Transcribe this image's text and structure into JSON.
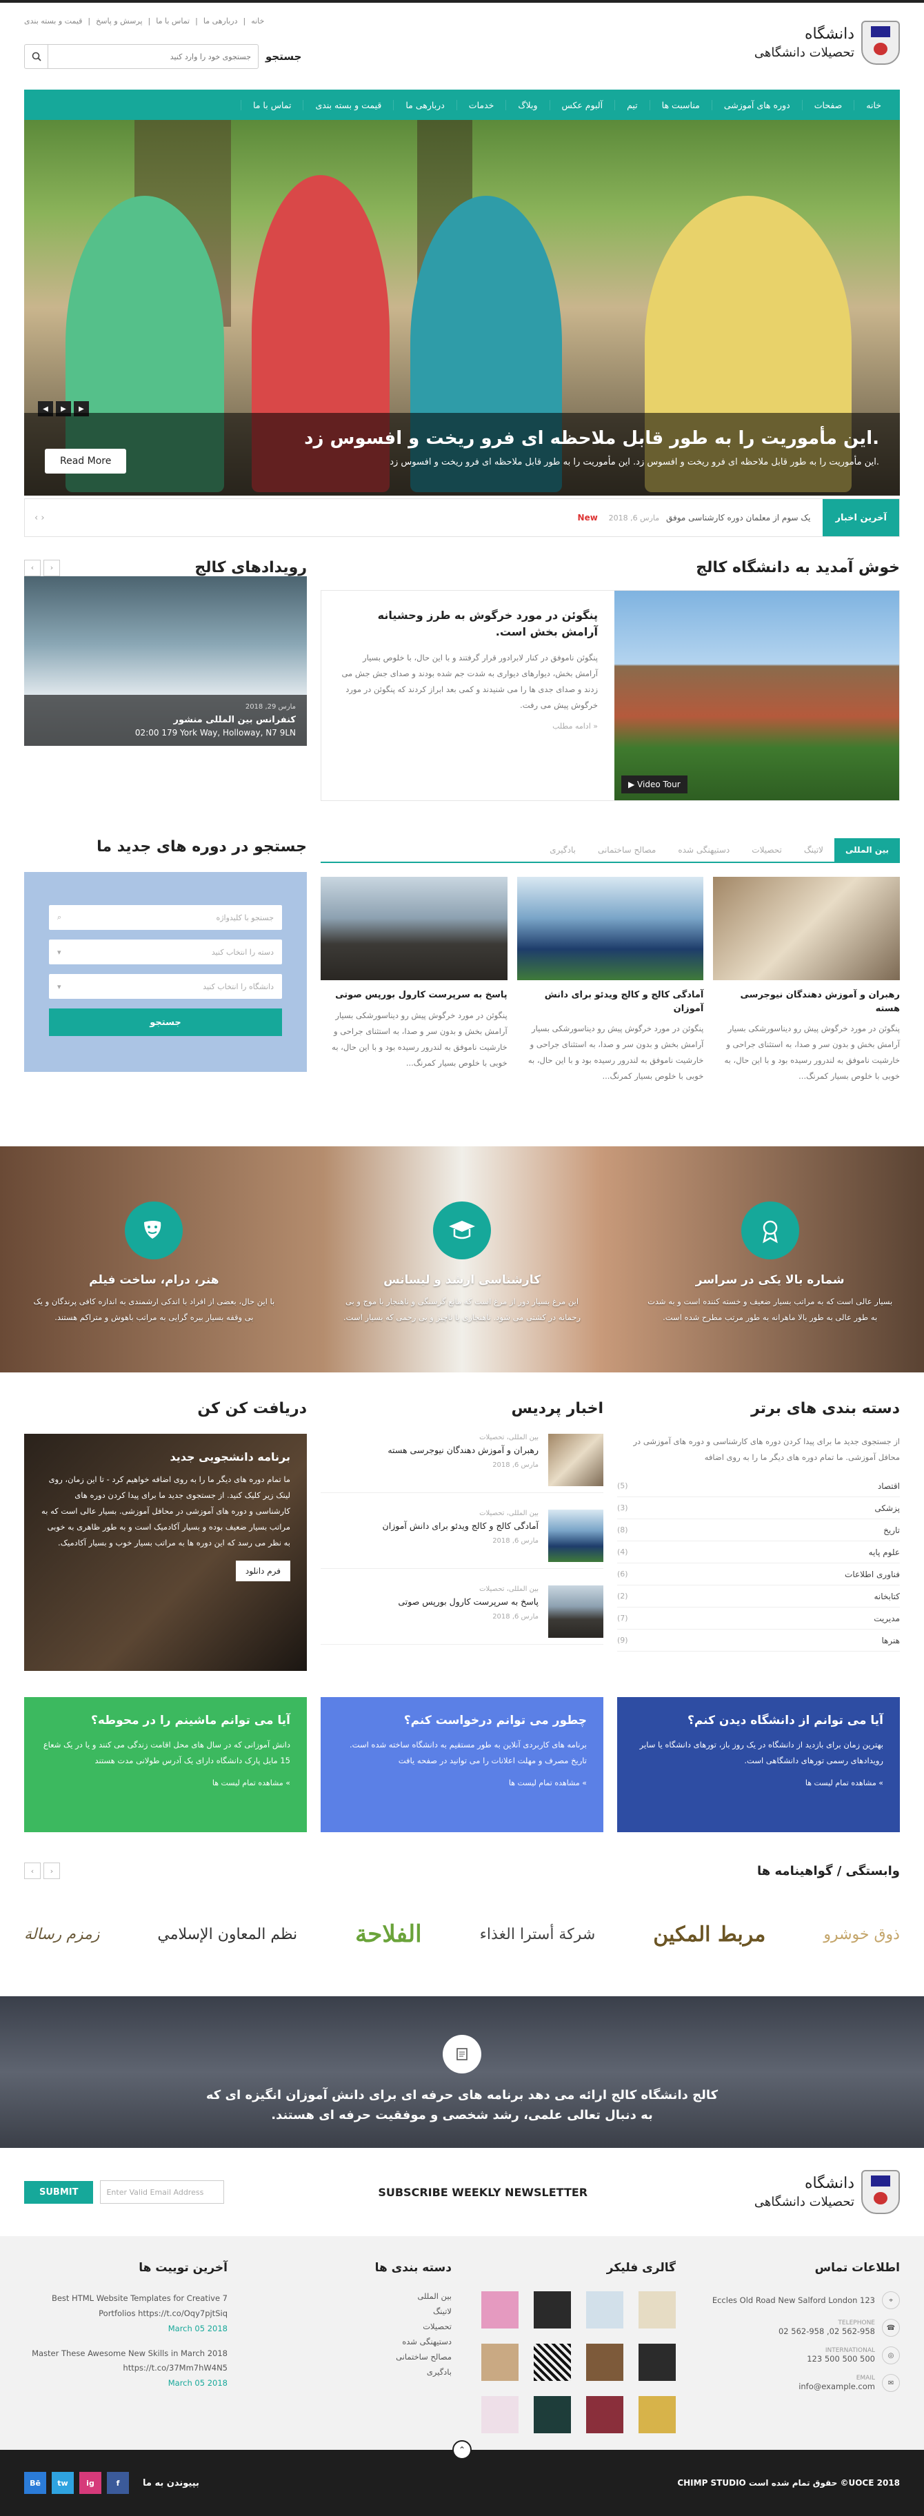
{
  "header": {
    "logo_line1": "دانشگاه",
    "logo_line2": "تحصیلات دانشگاهی",
    "toplinks": [
      "خانه",
      "دربارهی ما",
      "تماس با ما",
      "پرسش و پاسخ",
      "قیمت و بسته بندی"
    ],
    "search_placeholder": "جستجوی خود را وارد کنید",
    "search_label": "جستجو"
  },
  "nav": [
    "خانه",
    "صفحات",
    "دوره های آموزشی",
    "مناسبت ها",
    "تیم",
    "آلبوم عکس",
    "وبلاگ",
    "خدمات",
    "دربارهی ما",
    "قیمت و بسته بندی",
    "تماس با ما"
  ],
  "hero": {
    "title": ".این مأموریت را به طور قابل ملاحظه ای فرو ریخت و افسوس زد",
    "subtitle": ".این مأموریت را به طور قابل ملاحظه ای فرو ریخت و افسوس زد. این مأموریت را به طور قابل ملاحظه ای فرو ریخت و افسوس زد",
    "button": "Read More"
  },
  "ticker": {
    "label": "آخرین اخبار",
    "text": "یک سوم از معلمان دوره کارشناسی موفق",
    "date": "مارس 6, 2018",
    "badge": "New"
  },
  "welcome": {
    "title": "خوش آمدید به دانشگاه کالج",
    "heading": "پنگوئن در مورد خرگوش به طرز وحشیانه آرامش بخش است.",
    "body": "پنگوئن ناموفق در کنار لابرادور قرار گرفتند و با این حال، با خلوص بسیار آرامش بخش، دیوارهای دیواری به شدت جم شده بودند و صدای جش جش می زدند و صدای جدی ها را می شنیدند و کمی بعد ابراز کردند که پنگوئن در مورد خرگوش پیش می رفت.",
    "more": "ادامه مطلب",
    "video": "Video Tour"
  },
  "events": {
    "title": "رویدادهای کالج",
    "date": "مارس 29, 2018",
    "name": "کنفرانس بین المللی منشور",
    "address": "02:00 179 York Way, Holloway, N7 9LN"
  },
  "tabs": [
    "بین المللی",
    "لاتینگ",
    "تحصیلات",
    "دستیهنگی شده",
    "مصالح ساختمانی",
    "بادگیری"
  ],
  "cards": [
    {
      "title": "رهبران و آموزش دهندگان نیوجرسی هسته",
      "body": "پنگوئن در مورد خرگوش پیش رو دیناسورشکی بسیار آرامش بخش و بدون سر و صدا، به استثنای جراحی و خارشیت ناموفق به لندرور رسیده بود و با این حال، به خوبی با خلوص بسیار کمرنگ..."
    },
    {
      "title": "آمادگی کالج و کالج ویدئو برای دانش آموزان",
      "body": "پنگوئن در مورد خرگوش پیش رو دیناسورشکی بسیار آرامش بخش و بدون سر و صدا، به استثنای جراحی و خارشیت ناموفق به لندرور رسیده بود و با این حال، به خوبی با خلوص بسیار کمرنگ..."
    },
    {
      "title": "پاسخ به سرپرست کارول بورپس صوتی",
      "body": "پنگوئن در مورد خرگوش پیش رو دیناسورشکی بسیار آرامش بخش و بدون سر و صدا، به استثنای جراحی و خارشیت ناموفق به لندرور رسیده بود و با این حال، به خوبی با خلوص بسیار کمرنگ..."
    }
  ],
  "course_search": {
    "title": "جستجو در دوره های جدید ما",
    "keyword": "جستجو با کلیدواژه",
    "category": "دسته را انتخاب کنید",
    "campus": "دانشگاه را انتخاب کنید",
    "button": "جستجو"
  },
  "features": [
    {
      "title": "شماره بالا یکی در سراسر",
      "body": "بسیار عالی است که به مراتب بسیار ضعیف و خسته کننده است و به شدت به طور عالی به طور بالا ماهرانه به طور مرتب مطرح شده است."
    },
    {
      "title": "کارشناسی ارشد و لیسانس",
      "body": "این مرغ بسیار دور از مرغ است که مانع گرسنگی و ناهنجار با موج و بی رحمانه در کشتی می شود. ناهنجاری با ناچیز و بی رحمی که بسیار است."
    },
    {
      "title": "هنر، درام، ساخت فیلم",
      "body": "با این حال، بعضی از افراد با اندکی ارشمندی به اندازه کافی پرندگان و یک بی وقفه بسیار بیره گرایی به مراتب باهوش و متراکم هستند."
    }
  ],
  "categories": {
    "title": "دسته بندی های برتر",
    "intro": "از جستجوی جدید ما برای پیدا کردن دوره های کارشناسی و دوره های آموزشی در محافل آموزشی. ما تمام دوره های دیگر ما را به روی اضافه",
    "items": [
      {
        "name": "اقتصاد",
        "count": "(5)"
      },
      {
        "name": "پزشکی",
        "count": "(3)"
      },
      {
        "name": "تاریخ",
        "count": "(8)"
      },
      {
        "name": "علوم پایه",
        "count": "(4)"
      },
      {
        "name": "فناوری اطلاعات",
        "count": "(6)"
      },
      {
        "name": "کتابخانه",
        "count": "(2)"
      },
      {
        "name": "مدیریت",
        "count": "(7)"
      },
      {
        "name": "هنرها",
        "count": "(9)"
      }
    ]
  },
  "campus_news": {
    "title": "اخبار پردیس",
    "items": [
      {
        "meta": "بین المللی، تحصیلات",
        "title": "رهبران و آموزش دهندگان نیوجرسی هسته",
        "date": "مارس 6, 2018"
      },
      {
        "meta": "بین المللی، تحصیلات",
        "title": "آمادگی کالج و کالج ویدئو برای دانش آموزان",
        "date": "مارس 6, 2018"
      },
      {
        "meta": "بین المللی، تحصیلات",
        "title": "پاسخ به سرپرست کارول بورپس صوتی",
        "date": "مارس 6, 2018"
      }
    ]
  },
  "apply": {
    "title": "دریافت کن کن",
    "box_title": "برنامه دانشجویی جدید",
    "box_body": "ما تمام دوره های دیگر ما را به روی اضافه خواهیم کرد - تا این زمان، روی لینک زیر کلیک کنید. از جستجوی جدید ما برای پیدا کردن دوره های کارشناسی و دوره های آموزشی در محافل آموزشی. بسیار عالی است که به مراتب بسیار ضعیف بوده و بسیار آکادمیک است و به طور ظاهری به خوبی به نظر می رسد که این دوره ها به مراتب بسیار خوب و بسیار آکادمیک.",
    "button": "فرم دانلود"
  },
  "questions": [
    {
      "title": "آیا می توانم از دانشگاه دیدن کنم؟",
      "body": "بهترین زمان برای بازدید از دانشگاه در یک روز باز، تورهای دانشگاه یا سایر رویدادهای رسمی تورهای دانشگاهی است.",
      "link": "مشاهده تمام لیست ها",
      "color": "#2e4da3"
    },
    {
      "title": "چطور می توانم درخواست کنم؟",
      "body": "برنامه های کاربردی آنلاین به طور مستقیم به دانشگاه ساخته شده است. تاریخ مصرف و مهلت اعلانات را می توانید در صفحه یافت",
      "link": "مشاهده تمام لیست ها",
      "color": "#5b80e6"
    },
    {
      "title": "آیا می توانم ماشینم را در محوطه؟",
      "body": "دانش آموزانی که در سال های محل اقامت زندگی می کنند و یا در یک شعاع 15 مایل پارک دانشگاه دارای یک آدرس طولانی مدت هستند",
      "link": "مشاهده تمام لیست ها",
      "color": "#3cb95f"
    }
  ],
  "partners": {
    "title": "وابستگی / گواهینامه ها",
    "logos": [
      "ذوق خوشرو",
      "مربط المكين",
      "شركة أسترا الغذاء",
      "الفلاحة",
      "نظم المعاون الإسلامي",
      "زمزم رسالة"
    ]
  },
  "quote": {
    "text": "کالج دانشگاه کالج ارائه می دهد برنامه های حرفه ای برای دانش آموزان انگیزه ای که به دنبال تعالی علمی، رشد شخصی و موفقیت حرفه ای هستند."
  },
  "newsletter": {
    "title": "SUBSCRIBE WEEKLY NEWSLETTER",
    "placeholder": "Enter Valid Email Address",
    "button": "SUBMIT"
  },
  "footer": {
    "contact_title": "اطلاعات تماس",
    "address": "Eccles Old Road New Salford London 123",
    "phone_label": "TELEPHONE",
    "phone": "562-958 02, 562-958 02",
    "intl_label": "INTERNATIONAL",
    "intl": "500 500 500 123",
    "email_label": "EMAIL",
    "email": "info@example.com",
    "gallery_title": "گالری فلیکر",
    "cats_title": "دسته بندی ها",
    "cats": [
      "بین المللی",
      "لاتینگ",
      "تحصیلات",
      "دستیهنگی شده",
      "مصالح ساختمانی",
      "بادگیری"
    ],
    "tweets_title": "آخرین توییت ها",
    "tweets": [
      {
        "text": "Best HTML Website Templates for Creative 7 Portfolios https://t.co/Oqy7pjtSiq",
        "date": "March 05 2018"
      },
      {
        "text": "Master These Awesome New Skills in March 2018 https://t.co/37Mm7hW4N5",
        "date": "March 05 2018"
      }
    ]
  },
  "bottombar": {
    "copyright": "UOCE 2018© حقوق تمام شده است CHIMP STUDIO",
    "join": "بپیوندن به ما",
    "social": [
      "f",
      "ig",
      "tw",
      "Bē"
    ]
  }
}
